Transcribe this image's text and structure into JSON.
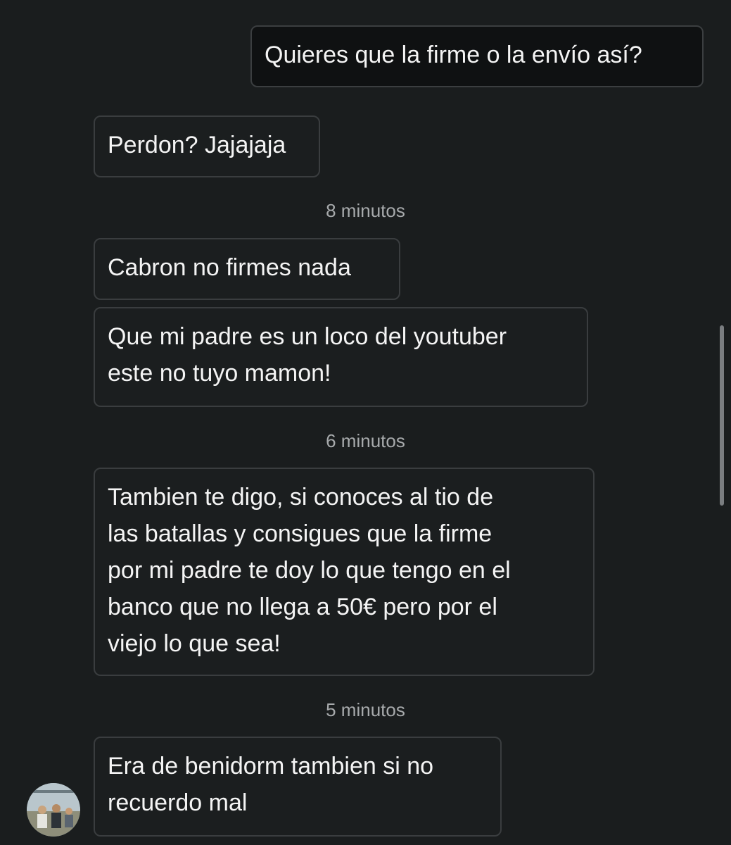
{
  "conversation": {
    "messages": [
      {
        "id": "m1",
        "direction": "outgoing",
        "text": "Quieres que la firme o la envío así?"
      },
      {
        "id": "m2",
        "direction": "incoming",
        "text": "Perdon? Jajajaja"
      },
      {
        "id": "m3",
        "direction": "incoming",
        "text": "Cabron no firmes nada"
      },
      {
        "id": "m4",
        "direction": "incoming",
        "text": "Que mi padre es un loco del youtuber\neste no tuyo mamon!"
      },
      {
        "id": "m5",
        "direction": "incoming",
        "text": "Tambien te digo, si conoces al tio de\nlas batallas y consigues que la firme\npor mi padre te doy lo que tengo en el\nbanco que no llega a 50€ pero por el\nviejo lo que sea!"
      },
      {
        "id": "m6",
        "direction": "incoming",
        "text": "Era de benidorm tambien si no\nrecuerdo mal"
      }
    ],
    "timestamps": {
      "t1": "8 minutos",
      "t2": "6 minutos",
      "t3": "5 minutos"
    }
  },
  "avatar": {
    "icon": "contact-avatar"
  },
  "colors": {
    "background": "#1a1d1e",
    "bubble_border": "#3a3d3f",
    "text": "#f4f4f4",
    "timestamp": "#a7aaac"
  }
}
